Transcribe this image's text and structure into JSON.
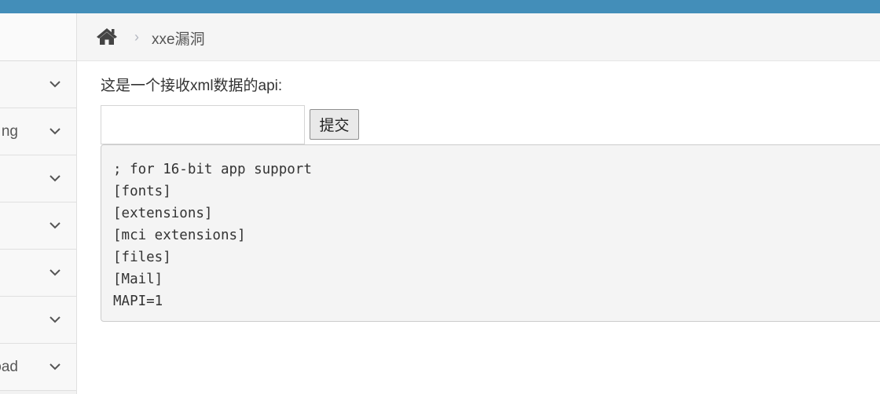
{
  "sidebar": {
    "items": [
      {
        "label": ""
      },
      {
        "label": "ng"
      },
      {
        "label": ""
      },
      {
        "label": ""
      },
      {
        "label": ""
      },
      {
        "label": ""
      },
      {
        "label": "load"
      }
    ]
  },
  "breadcrumb": {
    "home_icon": "home-icon",
    "current": "xxe漏洞"
  },
  "main": {
    "description": "这是一个接收xml数据的api:",
    "input": {
      "value": "",
      "placeholder": ""
    },
    "submit_label": "提交",
    "output_lines": [
      "; for 16-bit app support",
      "[fonts]",
      "[extensions]",
      "[mci extensions]",
      "[files]",
      "[Mail]",
      "MAPI=1"
    ]
  },
  "colors": {
    "topbar": "#438eb9",
    "sidebar_bg": "#f8f8f8",
    "breadcrumb_bg": "#f5f5f5",
    "output_bg": "#f4f4f4"
  }
}
